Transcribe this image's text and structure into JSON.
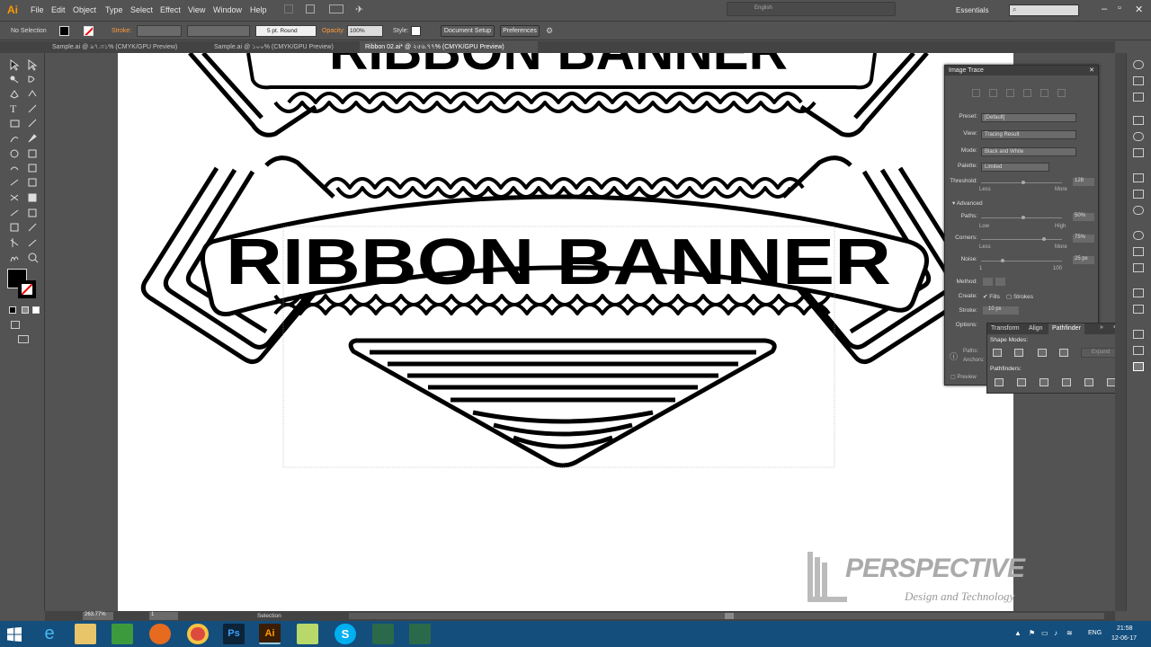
{
  "menubar": {
    "app_icon": "Ai",
    "items": [
      "File",
      "Edit",
      "Object",
      "Type",
      "Select",
      "Effect",
      "View",
      "Window",
      "Help"
    ],
    "language": "English",
    "workspace": "Essentials",
    "search_placeholder": ""
  },
  "control_bar": {
    "selection": "No Selection",
    "stroke_label": "Stroke:",
    "stroke_profile": "5 pt. Round",
    "opacity_label": "Opacity:",
    "opacity_value": "100%",
    "style_label": "Style:",
    "document_setup": "Document Setup",
    "preferences": "Preferences"
  },
  "tabs": [
    {
      "label": "Sample.ai @ ৯৭.৩১% (CMYK/GPU Preview)"
    },
    {
      "label": "Sample.ai @ ১০০% (CMYK/GPU Preview)"
    },
    {
      "label": "Ribbon 02.ai* @ ২৫৬.৭৭% (CMYK/GPU Preview)"
    }
  ],
  "artwork": {
    "title": "RIBBON BANNER"
  },
  "image_trace": {
    "title": "Image Trace",
    "preset_label": "Preset:",
    "preset_value": "[Default]",
    "view_label": "View:",
    "view_value": "Tracing Result",
    "mode_label": "Mode:",
    "mode_value": "Black and White",
    "palette_label": "Palette:",
    "palette_value": "Limited",
    "threshold_label": "Threshold:",
    "threshold_value": "128",
    "less": "Less",
    "more": "More",
    "advanced": "Advanced",
    "paths_label": "Paths:",
    "paths_value": "50%",
    "low": "Low",
    "high": "High",
    "corners_label": "Corners:",
    "corners_value": "75%",
    "noise_label": "Noise:",
    "noise_value": "25 px",
    "noise_min": "1",
    "noise_max": "100",
    "method_label": "Method:",
    "create_label": "Create:",
    "fills": "Fills",
    "strokes": "Strokes",
    "stroke_label": "Stroke:",
    "stroke_value": "10 px",
    "options_label": "Options:",
    "paths_info": "Paths:",
    "anchors_info": "Anchors:",
    "preview": "Preview"
  },
  "pathfinder": {
    "tabs": [
      "Transform",
      "Align",
      "Pathfinder"
    ],
    "shape_modes": "Shape Modes:",
    "expand": "Expand",
    "pathfinders": "Pathfinders:"
  },
  "status": {
    "zoom": "263.77%",
    "page": "1",
    "tool": "Selection"
  },
  "taskbar": {
    "lang": "ENG",
    "time": "21:58",
    "date": "12-06-17"
  },
  "logo": {
    "name": "PERSPECTIVE",
    "tagline": "Design and Technology"
  }
}
